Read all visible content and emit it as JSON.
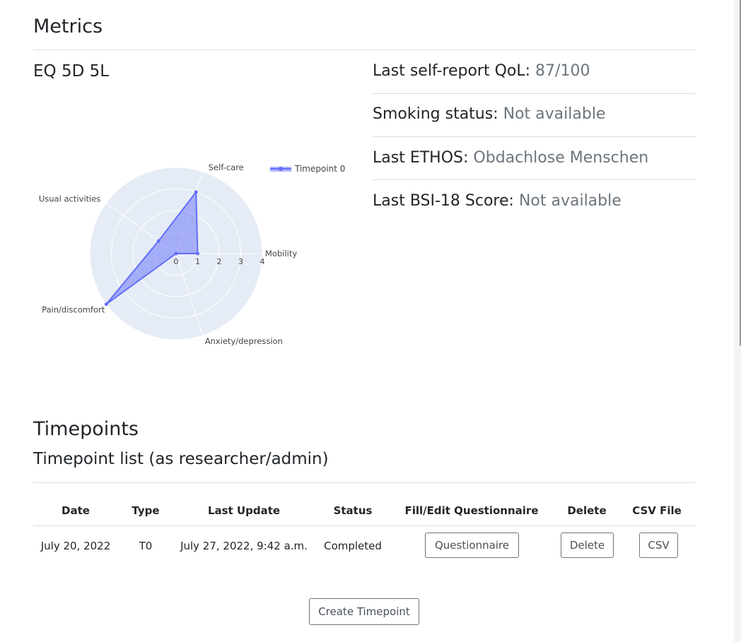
{
  "metrics": {
    "heading": "Metrics",
    "eq5d_title": "EQ 5D 5L",
    "qol_label": "Last self-report QoL:",
    "qol_value": "87/100",
    "smoking_label": "Smoking status:",
    "smoking_value": "Not available",
    "ethos_label": "Last ETHOS:",
    "ethos_value": "Obdachlose Menschen",
    "bsi_label": "Last BSI-18 Score:",
    "bsi_value": "Not available"
  },
  "chart_data": {
    "type": "radar",
    "axes": [
      "Mobility",
      "Self-care",
      "Usual activities",
      "Pain/discomfort",
      "Anxiety/depression"
    ],
    "radial_ticks": [
      "0",
      "1",
      "2",
      "3",
      "4"
    ],
    "range": [
      0,
      4
    ],
    "series": [
      {
        "name": "Timepoint 0",
        "values": [
          1,
          3,
          1,
          4,
          0
        ],
        "color": "#636efa"
      }
    ],
    "legend_position": "top-right",
    "background_color": "#e5ecf6"
  },
  "timepoints": {
    "heading": "Timepoints",
    "list_title": "Timepoint list (as researcher/admin)",
    "columns": [
      "Date",
      "Type",
      "Last Update",
      "Status",
      "Fill/Edit Questionnaire",
      "Delete",
      "CSV File"
    ],
    "rows": [
      {
        "date": "July 20, 2022",
        "type": "T0",
        "last_update": "July 27, 2022, 9:42 a.m.",
        "status": "Completed",
        "questionnaire_label": "Questionnaire",
        "delete_label": "Delete",
        "csv_label": "CSV"
      }
    ],
    "create_label": "Create Timepoint"
  }
}
